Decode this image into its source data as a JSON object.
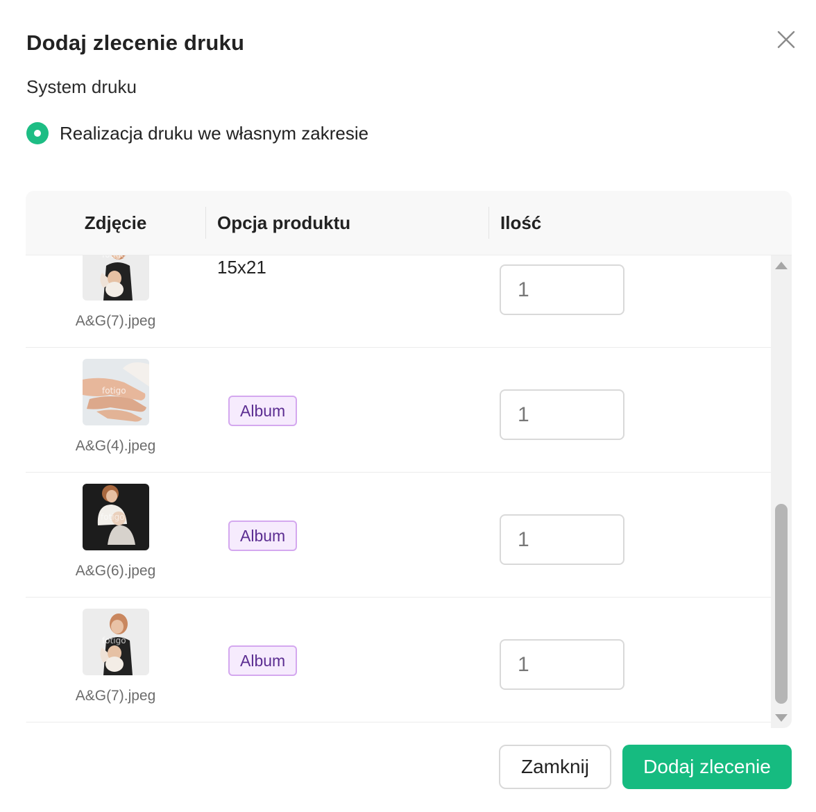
{
  "dialog": {
    "title": "Dodaj zlecenie druku",
    "print_system_label": "System druku",
    "print_option": "Realizacja druku we własnym zakresie",
    "accent_color": "#1dbd84"
  },
  "table": {
    "columns": [
      "Zdjęcie",
      "Opcja produktu",
      "Ilość"
    ],
    "rows": [
      {
        "file": "A&G(7).jpeg",
        "option": "15x21",
        "option_style": "text",
        "qty": "1",
        "thumb": "mother-baby-light"
      },
      {
        "file": "A&G(4).jpeg",
        "option": "Album",
        "option_style": "badge",
        "qty": "1",
        "thumb": "hands"
      },
      {
        "file": "A&G(6).jpeg",
        "option": "Album",
        "option_style": "badge",
        "qty": "1",
        "thumb": "mother-baby-dark"
      },
      {
        "file": "A&G(7).jpeg",
        "option": "Album",
        "option_style": "badge",
        "qty": "1",
        "thumb": "mother-baby-light"
      }
    ],
    "watermark": "fotigo"
  },
  "footer": {
    "close_label": "Zamknij",
    "submit_label": "Dodaj zlecenie",
    "submit_color": "#16bb80"
  }
}
